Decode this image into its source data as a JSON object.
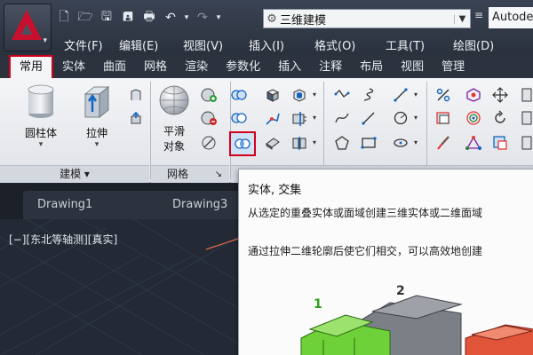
{
  "workspace": {
    "value": "三维建模",
    "brand": "Autodes"
  },
  "menubar": [
    "文件(F)",
    "编辑(E)",
    "视图(V)",
    "插入(I)",
    "格式(O)",
    "工具(T)",
    "绘图(D)"
  ],
  "ribbon_tabs": [
    {
      "label": "常用",
      "active": true
    },
    {
      "label": "实体"
    },
    {
      "label": "曲面"
    },
    {
      "label": "网格"
    },
    {
      "label": "渲染"
    },
    {
      "label": "参数化"
    },
    {
      "label": "插入"
    },
    {
      "label": "注释"
    },
    {
      "label": "布局"
    },
    {
      "label": "视图"
    },
    {
      "label": "管理"
    }
  ],
  "panels": {
    "modeling": {
      "title": "建模 ▾",
      "cylinder": "圆柱体",
      "extrude": "拉伸"
    },
    "mesh": {
      "title": "网格",
      "smooth_line1": "平滑",
      "smooth_line2": "对象",
      "launcher": "↘"
    }
  },
  "documents": [
    "Drawing1",
    "Drawing3"
  ],
  "viewport": {
    "label": "[−][东北等轴测][真实]"
  },
  "tooltip": {
    "title": "实体, 交集",
    "line1": "从选定的重叠实体或面域创建三维实体或二维面域",
    "line2": "通过拉伸二维轮廓后使它们相交，可以高效地创建",
    "label_1": "1",
    "label_2": "2"
  },
  "colors": {
    "highlight": "#d0021b",
    "accent_green": "#6fd13a",
    "accent_red": "#e0543a"
  },
  "icons": {
    "qat": [
      "new-icon",
      "open-icon",
      "save-icon",
      "save-as-icon",
      "print-icon",
      "undo-icon",
      "redo-icon"
    ],
    "small_tools": [
      "union-icon",
      "subtract-icon",
      "intersect-icon",
      "box-select-icon",
      "extract-edges-icon",
      "slice-icon",
      "fillet-icon",
      "shell-icon",
      "gizmo-icon",
      "polyline-icon",
      "spline-icon",
      "circle-icon",
      "pentagon-icon",
      "rectangle-icon"
    ]
  }
}
